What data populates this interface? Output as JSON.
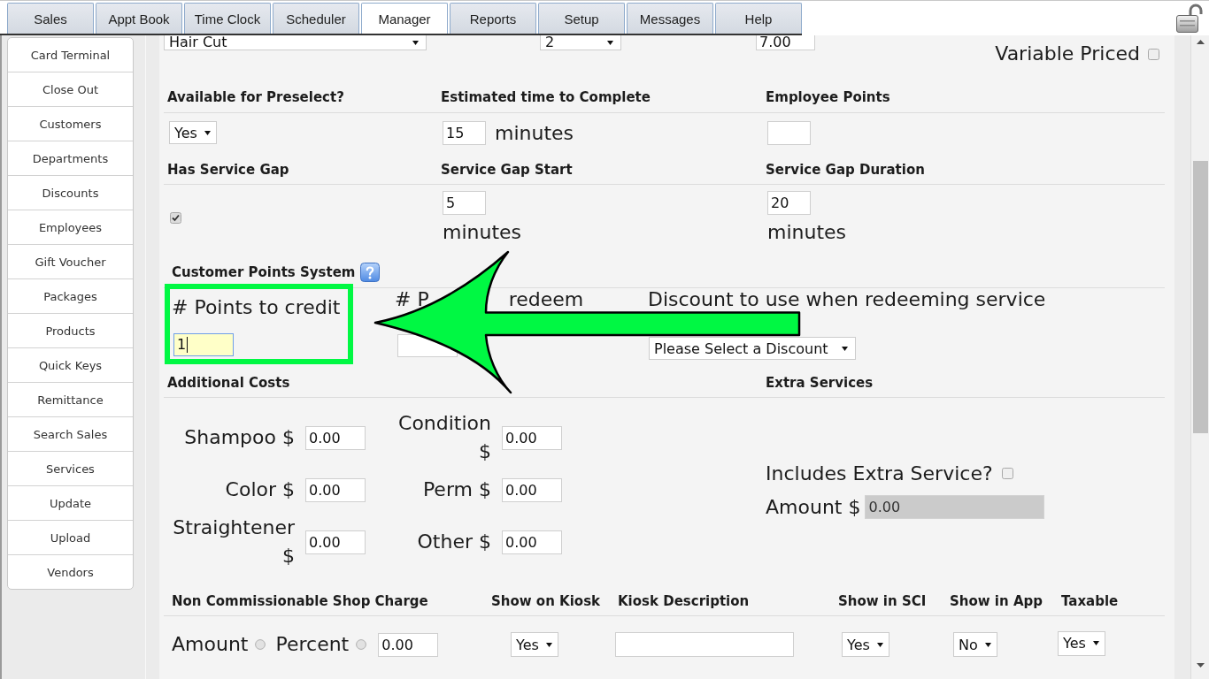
{
  "tabs": [
    {
      "label": "Sales",
      "selected": false
    },
    {
      "label": "Appt Book",
      "selected": false
    },
    {
      "label": "Time Clock",
      "selected": false
    },
    {
      "label": "Scheduler",
      "selected": false
    },
    {
      "label": "Manager",
      "selected": true
    },
    {
      "label": "Reports",
      "selected": false
    },
    {
      "label": "Setup",
      "selected": false
    },
    {
      "label": "Messages",
      "selected": false
    },
    {
      "label": "Help",
      "selected": false
    }
  ],
  "sidebar": {
    "items": [
      "Card Terminal",
      "Close Out",
      "Customers",
      "Departments",
      "Discounts",
      "Employees",
      "Gift Voucher",
      "Packages",
      "Products",
      "Quick Keys",
      "Remittance",
      "Search Sales",
      "Services",
      "Update",
      "Upload",
      "Vendors"
    ]
  },
  "top_row": {
    "fields": [
      {
        "kind": "select",
        "value": "Hair Cut"
      },
      {
        "kind": "select",
        "value": "2"
      },
      {
        "kind": "input",
        "value": "7.00"
      }
    ],
    "variable_priced": {
      "label": "Variable Priced",
      "checked": false
    }
  },
  "sections": [
    {
      "headings": [
        "Available for Preselect?",
        "Estimated time to Complete",
        "Employee Points"
      ],
      "cells": [
        {
          "kind": "select",
          "value": "Yes"
        },
        {
          "kind": "input",
          "value": "15",
          "unit": "minutes"
        },
        {
          "kind": "input"
        }
      ]
    },
    {
      "headings": [
        "Has Service Gap",
        "Service Gap Start",
        "Service Gap Duration"
      ],
      "cells": [
        {
          "kind": "checkbox",
          "checked": true
        },
        {
          "kind": "input",
          "value": "5",
          "unit": "minutes"
        },
        {
          "kind": "input",
          "value": "20",
          "unit": "minutes"
        }
      ]
    }
  ],
  "points": {
    "title": "Customer Points System",
    "credit": {
      "label": "# Points to credit",
      "value": "1",
      "focused": true,
      "highlighted": true,
      "pointed_at": true
    },
    "redeem": {
      "label_visible": [
        "# P",
        "redeem"
      ]
    },
    "discount": {
      "label": "Discount to use when redeeming service",
      "value": "Please Select a Discount"
    }
  },
  "additional_costs": {
    "title": "Additional Costs",
    "rows": [
      [
        {
          "label": "Shampoo $",
          "value": "0.00"
        },
        {
          "label": "Condition $",
          "value": "0.00"
        }
      ],
      [
        {
          "label": "Color $",
          "value": "0.00"
        },
        {
          "label": "Perm $",
          "value": "0.00"
        }
      ],
      [
        {
          "label": "Straightener $",
          "value": "0.00"
        },
        {
          "label": "Other $",
          "value": "0.00"
        }
      ]
    ]
  },
  "extra_services": {
    "title": "Extra Services",
    "includes": {
      "label": "Includes Extra Service?",
      "checked": false
    },
    "amount": {
      "label": "Amount $",
      "value": "0.00",
      "disabled": true
    }
  },
  "shop_charge": {
    "headings": [
      "Non Commissionable Shop Charge",
      "Show on Kiosk",
      "Kiosk Description",
      "Show in SCI",
      "Show in App",
      "Taxable"
    ],
    "charge_types": [
      {
        "label": "Amount",
        "selected": false
      },
      {
        "label": "Percent",
        "selected": false
      }
    ],
    "charge_value": "0.00",
    "show_on_kiosk": "Yes",
    "show_in_sci": "Yes",
    "show_in_app": "No",
    "taxable": "Yes"
  }
}
